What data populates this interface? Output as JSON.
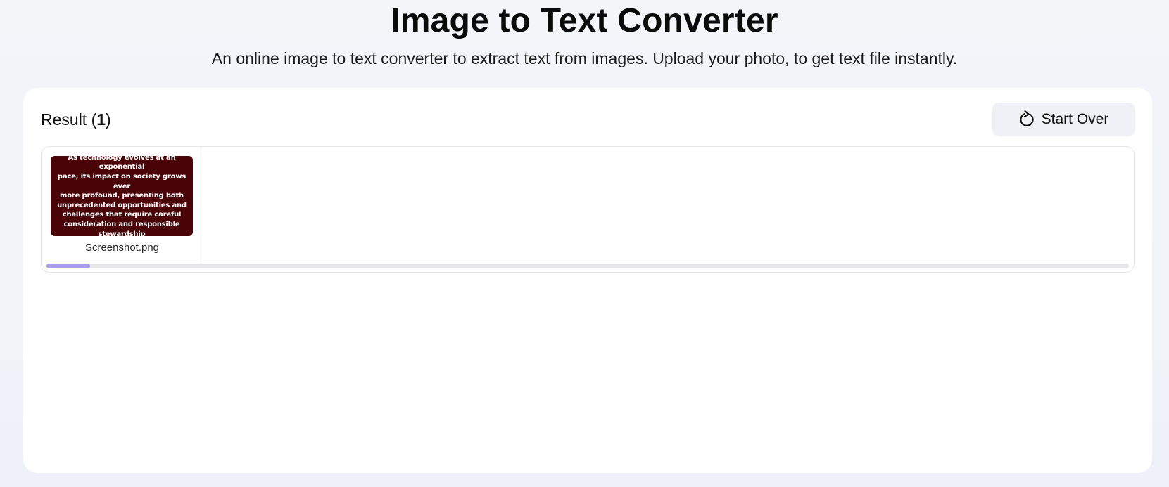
{
  "header": {
    "title": "Image to Text Converter",
    "subtitle": "An online image to text converter to extract text from images. Upload your photo, to get text file instantly."
  },
  "result": {
    "label": "Result (",
    "count": "1",
    "close_paren": ")",
    "start_over_label": "Start Over",
    "start_over_icon": "refresh-icon"
  },
  "files": [
    {
      "name": "Screenshot.png",
      "thumbnail_text": "As technology evolves at an exponential\npace, its impact on society grows ever\nmore profound, presenting both\nunprecedented opportunities and\nchallenges that require careful\nconsideration and responsible stewardship",
      "thumbnail_bg": "#4a0306"
    }
  ],
  "progress": {
    "fraction": 0.04,
    "color": "#a99af2"
  }
}
